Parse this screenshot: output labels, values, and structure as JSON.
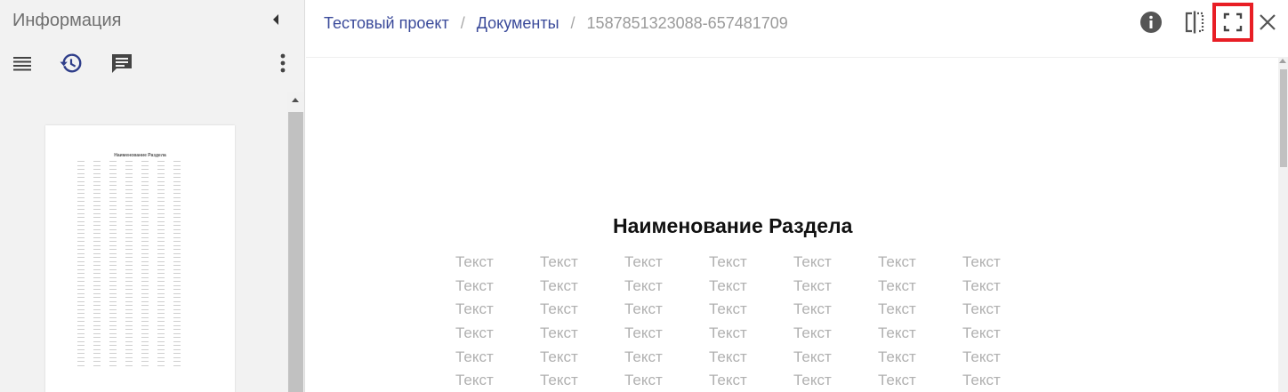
{
  "sidebar": {
    "title": "Информация",
    "tools": {
      "list": "list-icon",
      "history": "history-icon",
      "comments": "comment-icon",
      "more": "more-vert-icon"
    },
    "thumbnail": {
      "title": "Наименование Раздела",
      "cell_text": "Текст"
    }
  },
  "breadcrumb": {
    "items": [
      "Тестовый проект",
      "Документы"
    ],
    "current": "1587851323088-657481709",
    "separator": "/"
  },
  "toolbar": {
    "info": "info-icon",
    "compare": "compare-icon",
    "fullscreen": "fullscreen-icon",
    "close": "close-icon"
  },
  "document": {
    "title": "Наименование Раздела",
    "cell_text": "Текст",
    "columns": 7,
    "visible_rows": 6
  },
  "colors": {
    "accent": "#3a4a9a",
    "highlight": "#e81e25",
    "muted_text": "#b0b0b0"
  }
}
